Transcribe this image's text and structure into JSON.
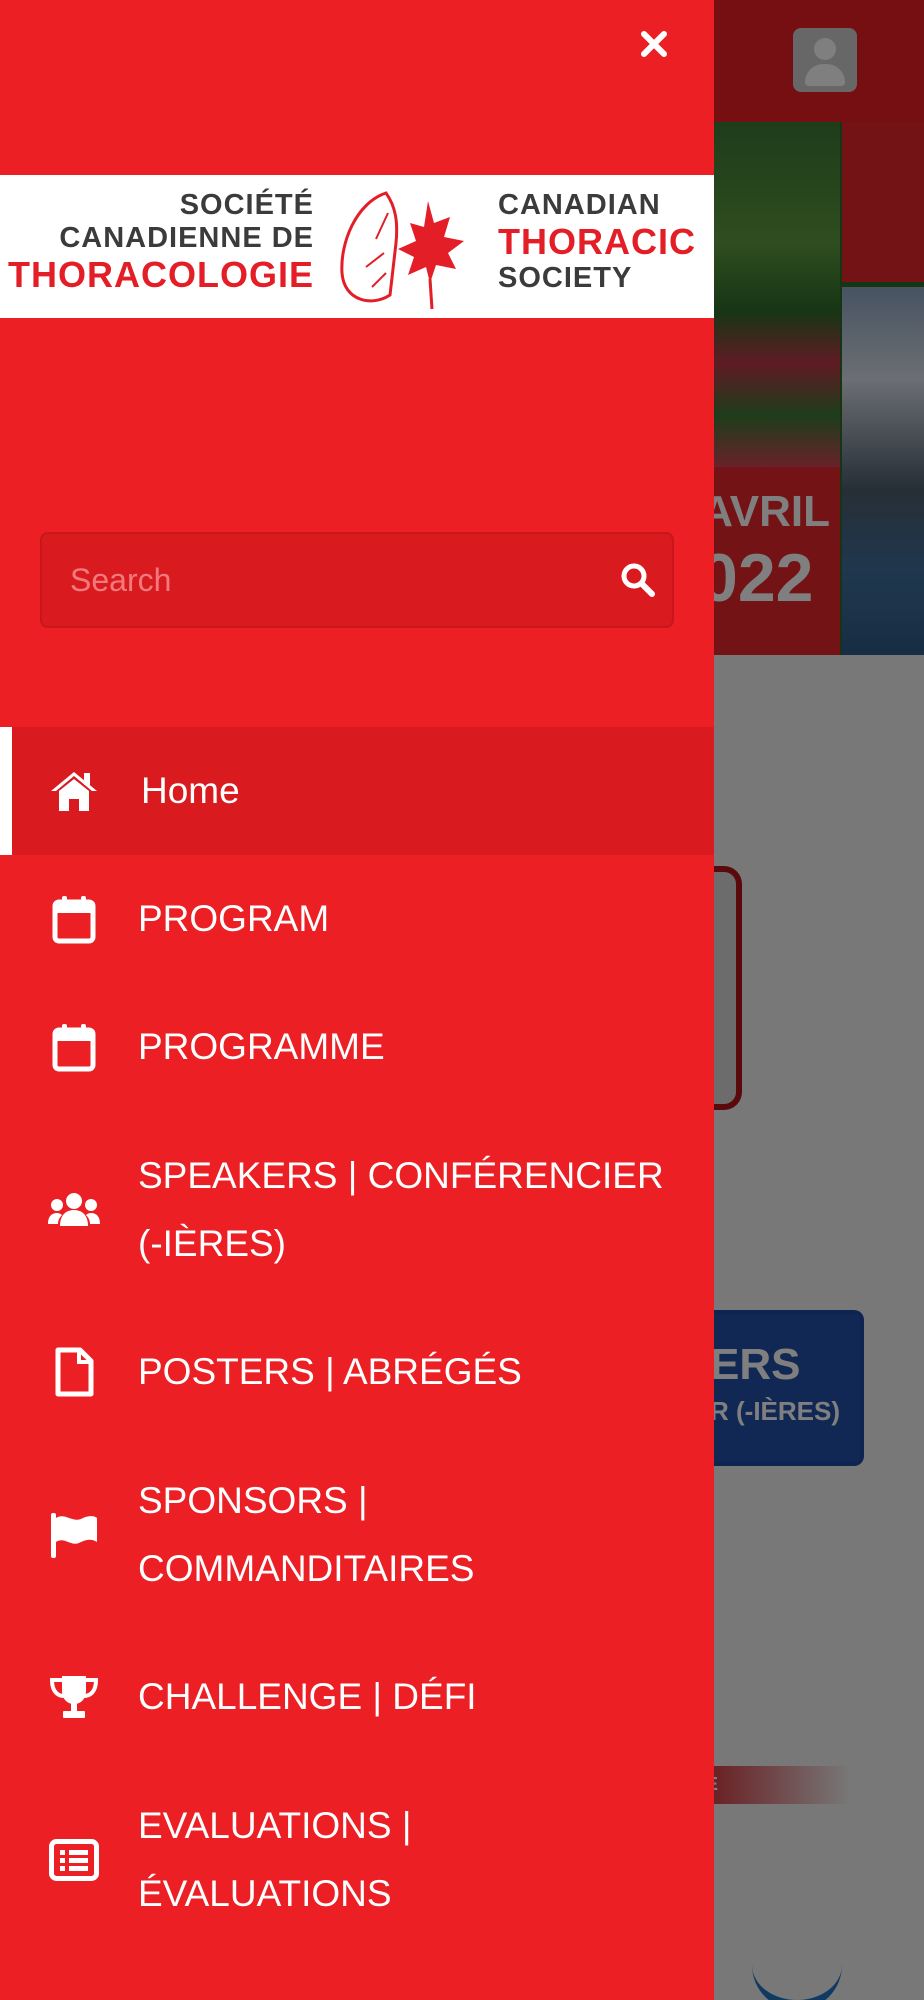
{
  "background": {
    "banner": {
      "month": "AVRIL",
      "year_fragment": "022"
    },
    "card_blue": {
      "line1": "ERS",
      "line2": "R (-IÈRES)"
    },
    "stripe_text": "E"
  },
  "drawer": {
    "logo": {
      "fr_line1": "SOCIÉTÉ",
      "fr_line2": "CANADIENNE DE",
      "fr_line3": "THORACOLOGIE",
      "en_line1": "CANADIAN",
      "en_line2": "THORACIC",
      "en_line3": "SOCIETY"
    },
    "search": {
      "placeholder": "Search"
    },
    "menu": [
      {
        "label": "Home",
        "icon": "home-icon",
        "active": true
      },
      {
        "label": "PROGRAM",
        "icon": "calendar-icon"
      },
      {
        "label": "PROGRAMME",
        "icon": "calendar-icon"
      },
      {
        "label": "SPEAKERS | CONFÉRENCIER (-IÈRES)",
        "icon": "users-icon"
      },
      {
        "label": "POSTERS | ABRÉGÉS",
        "icon": "file-icon"
      },
      {
        "label": "SPONSORS | COMMANDITAIRES",
        "icon": "flag-icon"
      },
      {
        "label": "CHALLENGE | DÉFI",
        "icon": "trophy-icon"
      },
      {
        "label": "EVALUATIONS | ÉVALUATIONS",
        "icon": "list-icon"
      }
    ]
  },
  "colors": {
    "brand_red": "#ec1f24",
    "active_red": "#d91b20",
    "logo_gray": "#3b3b3b"
  }
}
